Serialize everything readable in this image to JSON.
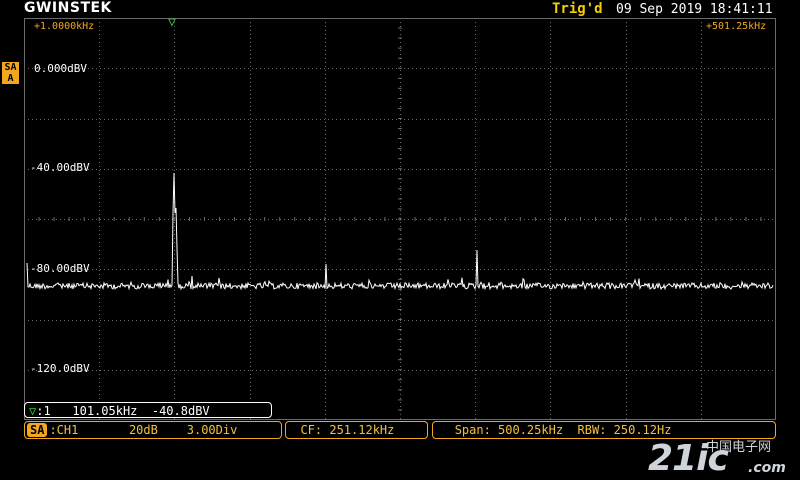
{
  "header": {
    "brand": "GWINSTEK",
    "trigger_status": "Trig'd",
    "date": "09 Sep 2019",
    "time": "18:41:11"
  },
  "spectrum": {
    "start_freq": "+1.0000kHz",
    "stop_freq": "+501.25kHz",
    "mode_tag_top": "SA",
    "mode_tag_bottom": "A",
    "y_labels": [
      "0.000dBV",
      "-40.00dBV",
      "-80.00dBV",
      "-120.0dBV"
    ],
    "trace_color": "#ffffff",
    "grid_color": "#6a6a6a"
  },
  "marker": {
    "icon": "triangle-down-marker-icon",
    "index": ":1",
    "frequency": "101.05kHz",
    "level": "-40.8dBV"
  },
  "status": {
    "sa_badge": "SA",
    "source": ":CH1",
    "scale": "20dB",
    "divs": "3.00Div",
    "cf": "CF: 251.12kHz",
    "span": "Span: 500.25kHz",
    "rbw": "RBW: 250.12Hz"
  },
  "watermark": {
    "big": "21ic",
    "cn": "中国电子网",
    "com": ".com"
  },
  "colors": {
    "accent": "#f2a81d",
    "trigger": "#f2d000",
    "marker": "#2fd12f"
  }
}
